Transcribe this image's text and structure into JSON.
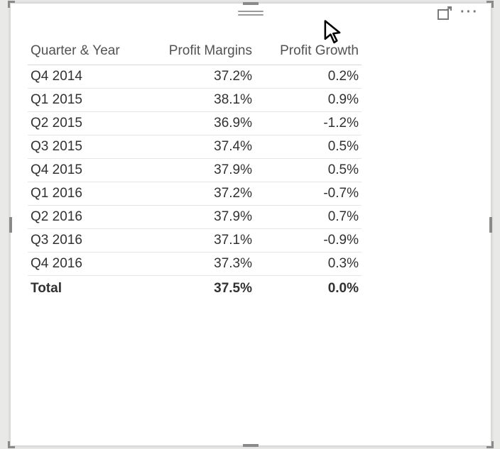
{
  "chart_data": {
    "type": "table",
    "columns": [
      "Quarter & Year",
      "Profit Margins",
      "Profit Growth"
    ],
    "rows": [
      {
        "label": "Q4 2014",
        "margin": "37.2%",
        "growth": "0.2%"
      },
      {
        "label": "Q1 2015",
        "margin": "38.1%",
        "growth": "0.9%"
      },
      {
        "label": "Q2 2015",
        "margin": "36.9%",
        "growth": "-1.2%"
      },
      {
        "label": "Q3 2015",
        "margin": "37.4%",
        "growth": "0.5%"
      },
      {
        "label": "Q4 2015",
        "margin": "37.9%",
        "growth": "0.5%"
      },
      {
        "label": "Q1 2016",
        "margin": "37.2%",
        "growth": "-0.7%"
      },
      {
        "label": "Q2 2016",
        "margin": "37.9%",
        "growth": "0.7%"
      },
      {
        "label": "Q3 2016",
        "margin": "37.1%",
        "growth": "-0.9%"
      },
      {
        "label": "Q4 2016",
        "margin": "37.3%",
        "growth": "0.3%"
      }
    ],
    "total": {
      "label": "Total",
      "margin": "37.5%",
      "growth": "0.0%"
    }
  },
  "ui": {
    "more_glyph": "···"
  }
}
